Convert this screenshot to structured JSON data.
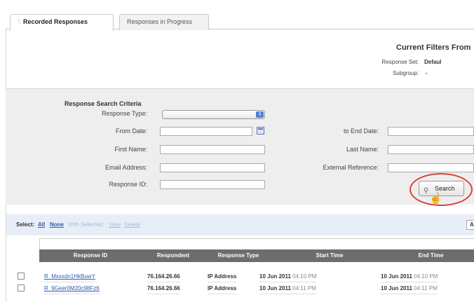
{
  "tabs": [
    {
      "label": "Recorded Responses",
      "active": true
    },
    {
      "label": "Responses in Progress",
      "active": false
    }
  ],
  "filters": {
    "title": "Current Filters From",
    "response_set_label": "Response Set:",
    "response_set_value": "Defaul",
    "subgroup_label": "Subgroup:",
    "subgroup_value": "-"
  },
  "criteria": {
    "title": "Response Search Criteria",
    "response_type_label": "Response Type:",
    "response_type_value": "",
    "from_date_label": "From Date:",
    "from_date_value": "",
    "to_end_date_label": "to End Date:",
    "to_end_date_value": "",
    "first_name_label": "First Name:",
    "first_name_value": "",
    "last_name_label": "Last Name:",
    "last_name_value": "",
    "email_label": "Email Address:",
    "email_value": "",
    "external_ref_label": "External Reference:",
    "external_ref_value": "",
    "response_id_label": "Response ID:",
    "response_id_value": "",
    "search_label": "Search"
  },
  "results": {
    "select_label": "Select:",
    "all_label": "All",
    "none_label": "None",
    "with_selected_label": "With Selected:",
    "view_label": "View",
    "delete_label": "Delete",
    "right_box_label": "A",
    "columns": [
      "Response ID",
      "Respondent",
      "Response Type",
      "Start Time",
      "End Time"
    ],
    "rows": [
      {
        "id": "R_Mxxxdn1HkBuwY",
        "respondent": "76.164.26.66",
        "type": "IP Address",
        "start_date": "10 Jun 2011",
        "start_time": "04:10 PM",
        "end_date": "10 Jun 2011",
        "end_time": "04:10 PM"
      },
      {
        "id": "R_9Geer0M20c98Fz6",
        "respondent": "76.164.26.66",
        "type": "IP Address",
        "start_date": "10 Jun 2011",
        "start_time": "04:11 PM",
        "end_date": "10 Jun 2011",
        "end_time": "04:11 PM"
      }
    ]
  },
  "colors": {
    "accent_link": "#2a5db0",
    "table_header": "#6d6d6d",
    "highlight_circle": "#d9403a",
    "panel_bg": "#eeeeee"
  }
}
